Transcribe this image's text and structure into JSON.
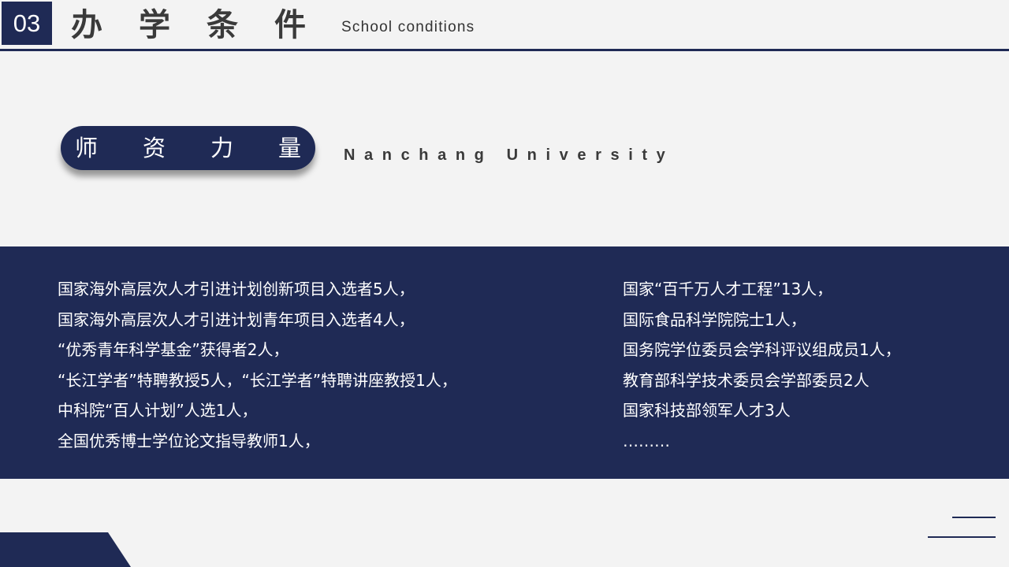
{
  "header": {
    "section_number": "03",
    "title": "办学条件",
    "subtitle": "School conditions"
  },
  "highlight": {
    "label": "师资力量",
    "caption": "Nanchang University"
  },
  "faculty": {
    "left_items": [
      "国家海外高层次人才引进计划创新项目入选者5人，",
      "国家海外高层次人才引进计划青年项目入选者4人，",
      "“优秀青年科学基金”获得者2人，",
      "“长江学者”特聘教授5人，“长江学者”特聘讲座教授1人，",
      "中科院“百人计划”人选1人，",
      "全国优秀博士学位论文指导教师1人，"
    ],
    "right_items": [
      "国家“百千万人才工程”13人，",
      "国际食品科学院院士1人，",
      "国务院学位委员会学科评议组成员1人，",
      "教育部科学技术委员会学部委员2人",
      "国家科技部领军人才3人",
      "………"
    ]
  },
  "colors": {
    "navy": "#1f2a55",
    "background": "#f3f3f3",
    "text_dark": "#3a3a3a"
  }
}
